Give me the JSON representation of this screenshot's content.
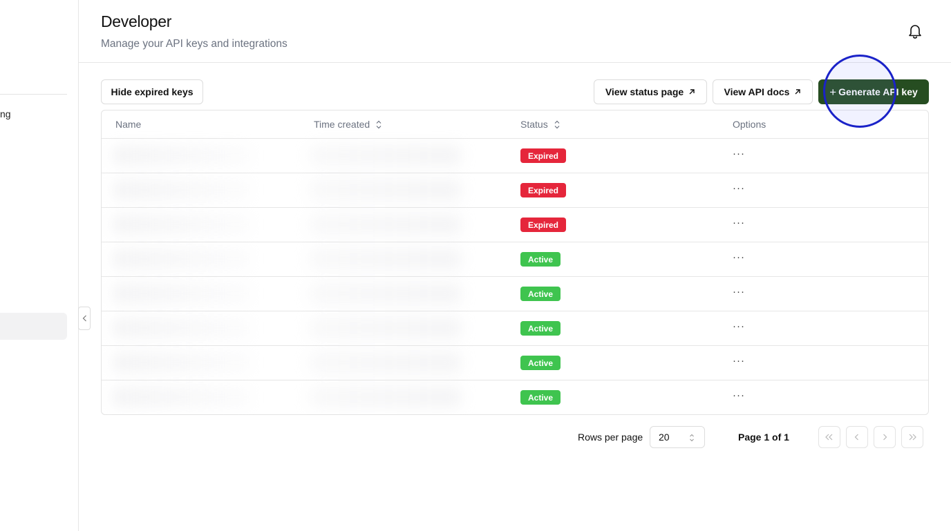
{
  "sidebar": {
    "fragment_text": "ng"
  },
  "header": {
    "title": "Developer",
    "subtitle": "Manage your API keys and integrations"
  },
  "toolbar": {
    "hide_expired_label": "Hide expired keys",
    "view_status_label": "View status page",
    "view_docs_label": "View API docs",
    "generate_plus": "+",
    "generate_label": "Generate API key"
  },
  "table": {
    "columns": {
      "name": "Name",
      "time_created": "Time created",
      "status": "Status",
      "options": "Options"
    },
    "rows": [
      {
        "status": "Expired",
        "options": "···"
      },
      {
        "status": "Expired",
        "options": "···"
      },
      {
        "status": "Expired",
        "options": "···"
      },
      {
        "status": "Active",
        "options": "···"
      },
      {
        "status": "Active",
        "options": "···"
      },
      {
        "status": "Active",
        "options": "···"
      },
      {
        "status": "Active",
        "options": "···"
      },
      {
        "status": "Active",
        "options": "···"
      }
    ]
  },
  "pagination": {
    "rows_per_page_label": "Rows per page",
    "rows_per_page_value": "20",
    "page_info": "Page 1 of 1"
  },
  "colors": {
    "primary": "#264d21",
    "expired": "#e5263b",
    "active": "#3fc44f",
    "highlight_ring": "#1a22c8"
  },
  "icons": {
    "bell": "bell-icon",
    "external_link": "arrow-up-right-icon",
    "sort": "chevron-up-down-icon",
    "collapse": "chevron-left-icon"
  }
}
